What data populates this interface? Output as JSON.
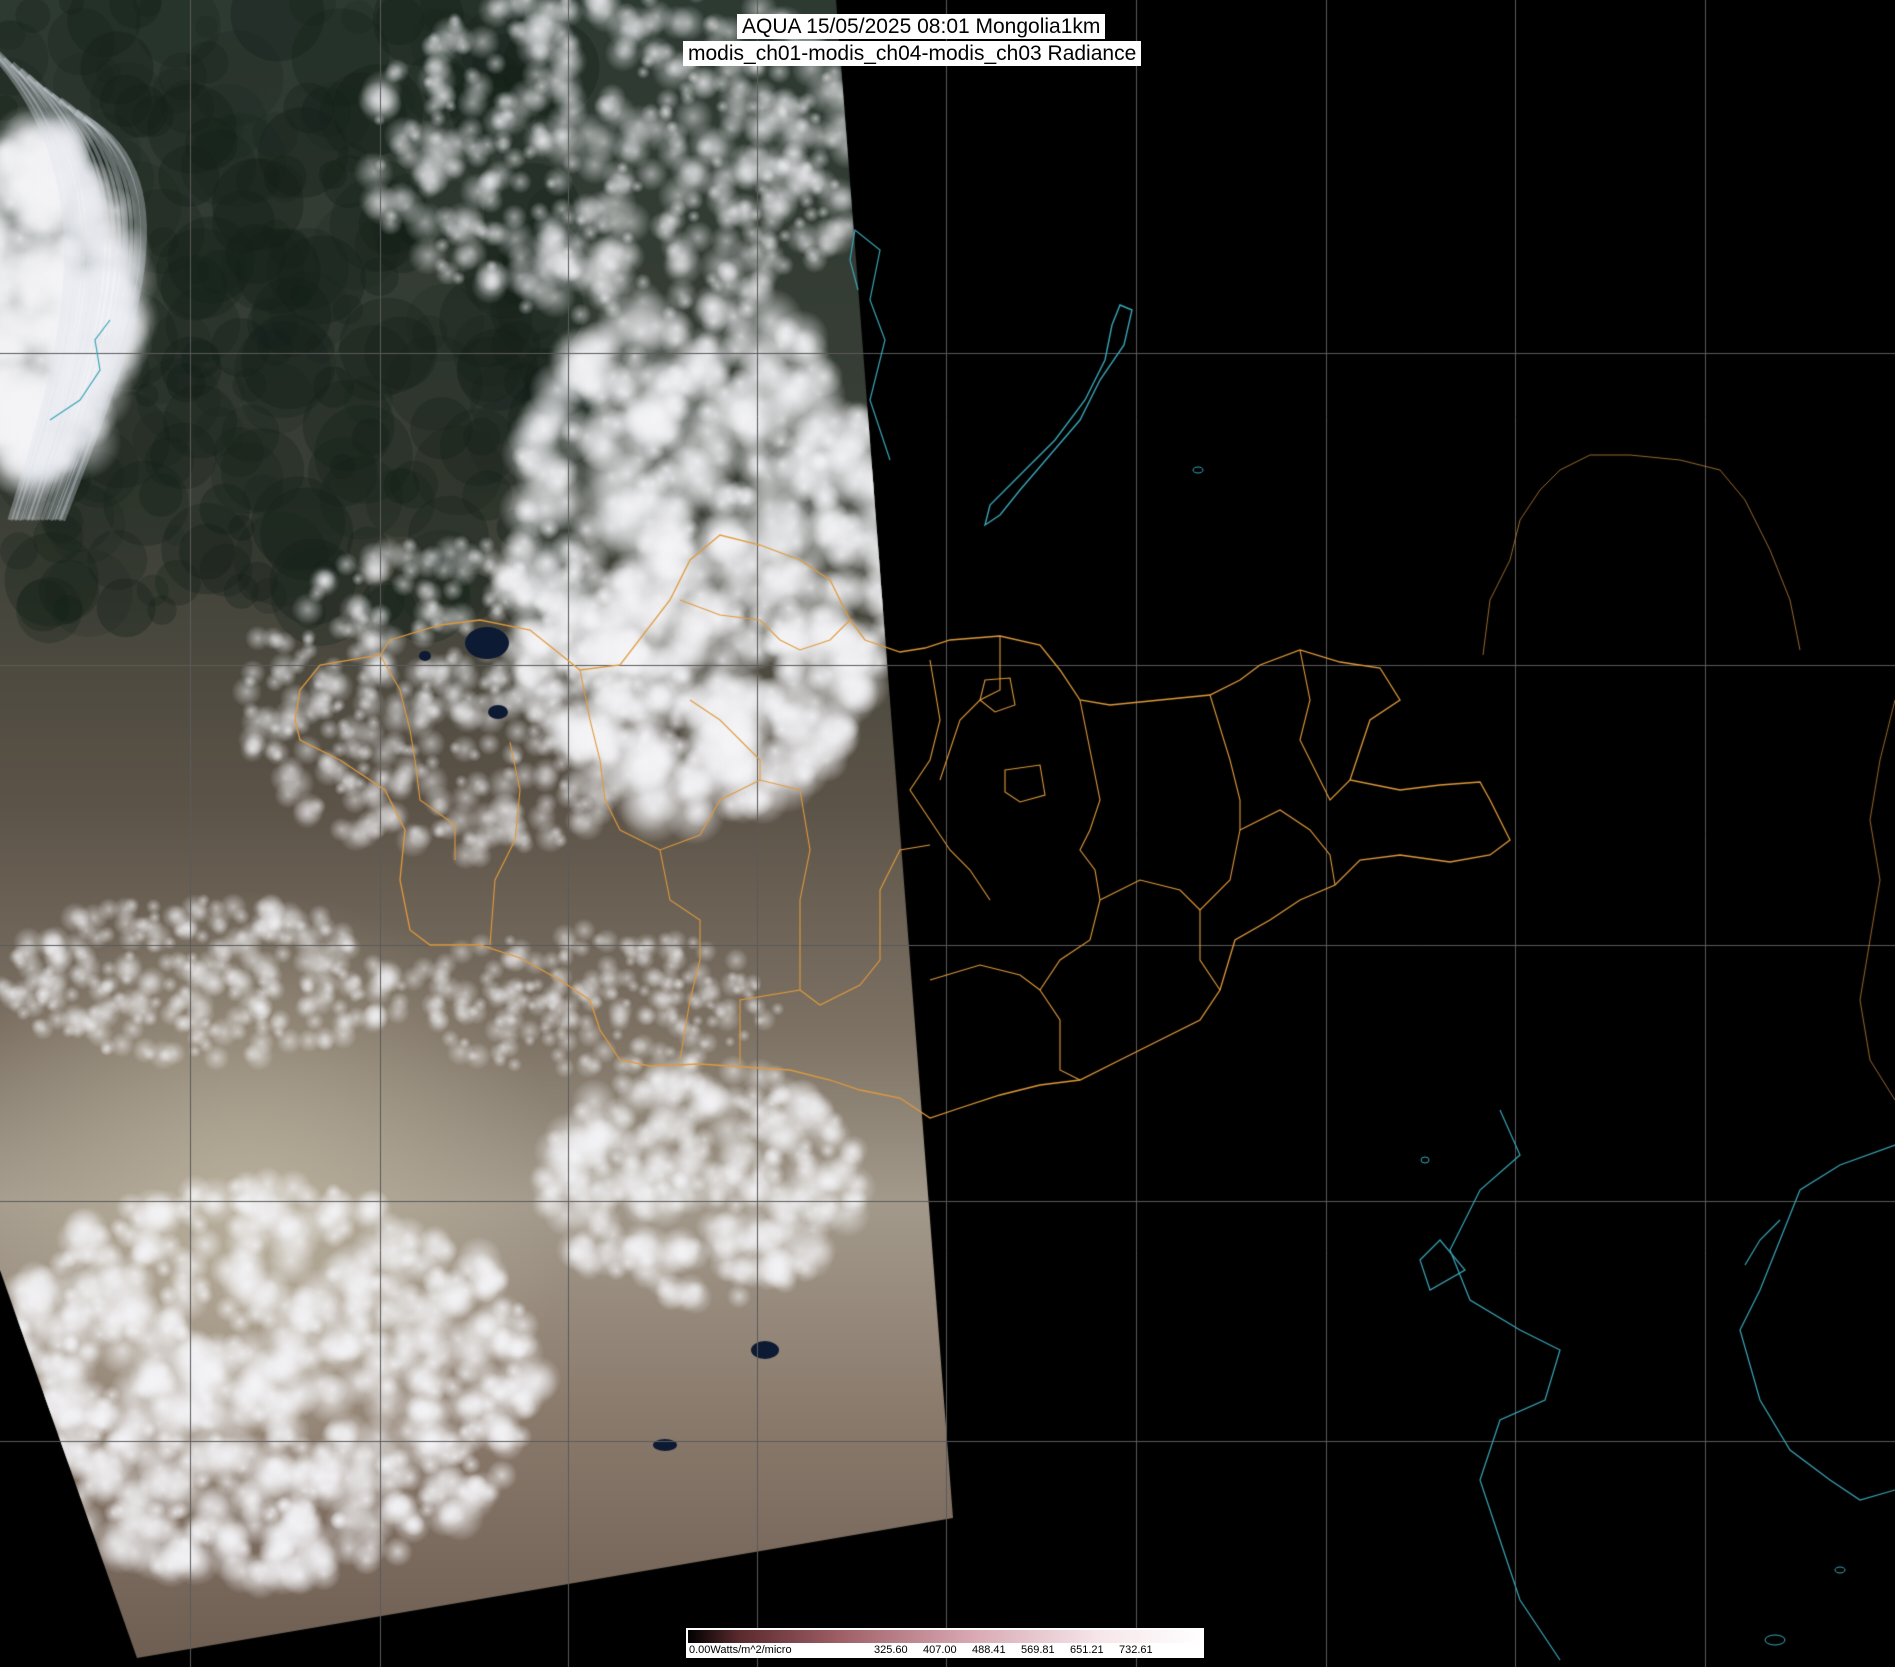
{
  "title": {
    "line1": "AQUA 15/05/2025 08:01 Mongolia1km",
    "line2": "modis_ch01-modis_ch04-modis_ch03 Radiance"
  },
  "colorbar": {
    "labels": [
      "0.00Watts/m^2/micro",
      "325.60",
      "407.00",
      "488.41",
      "569.81",
      "651.21",
      "732.61"
    ]
  },
  "colors": {
    "background": "#000000",
    "borders": "#e09a3c",
    "coastlines": "#3aa6b8",
    "grid": "#5a5a5a"
  }
}
